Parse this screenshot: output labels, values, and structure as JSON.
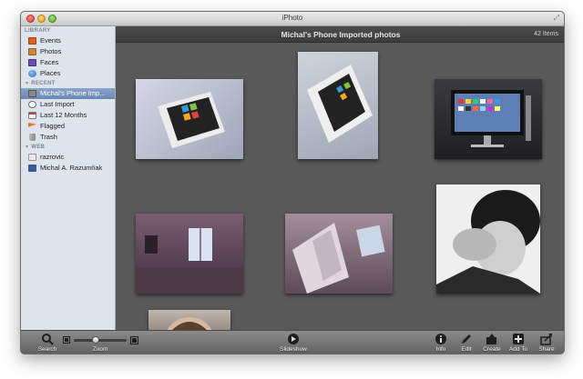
{
  "window": {
    "title": "iPhoto"
  },
  "sidebar": {
    "sections": [
      {
        "label": "LIBRARY",
        "items": [
          {
            "label": "Events",
            "icon": "events-icon",
            "color": "#d8642a"
          },
          {
            "label": "Photos",
            "icon": "photos-icon",
            "color": "#c88a3a"
          },
          {
            "label": "Faces",
            "icon": "faces-icon",
            "color": "#6a4fb0"
          },
          {
            "label": "Places",
            "icon": "places-icon",
            "color": "#3d7bc7"
          }
        ]
      },
      {
        "label": "RECENT",
        "items": [
          {
            "label": "Michal's Phone Imp...",
            "icon": "phone-import-icon",
            "color": "#8a8a8a",
            "selected": true
          },
          {
            "label": "Last Import",
            "icon": "clock-icon",
            "color": "#777777"
          },
          {
            "label": "Last 12 Months",
            "icon": "calendar-icon",
            "color": "#c93b3b"
          },
          {
            "label": "Flagged",
            "icon": "flag-icon",
            "color": "#e0772a"
          },
          {
            "label": "Trash",
            "icon": "trash-icon",
            "color": "#9a9a9a"
          }
        ]
      },
      {
        "label": "WEB",
        "items": [
          {
            "label": "razrovic",
            "icon": "flickr-icon",
            "color": "#e33a8f"
          },
          {
            "label": "Michal A. Razumňak",
            "icon": "facebook-icon",
            "color": "#3b5998"
          }
        ]
      }
    ]
  },
  "content": {
    "album_title": "Michal's Phone Imported photos",
    "item_count": "42 Items"
  },
  "toolbar": {
    "search": "Search",
    "zoom": "Zoom",
    "zoom_level": 0.4,
    "slideshow": "Slideshow",
    "info": "Info",
    "edit": "Edit",
    "create": "Create",
    "add_to": "Add To",
    "share": "Share"
  }
}
